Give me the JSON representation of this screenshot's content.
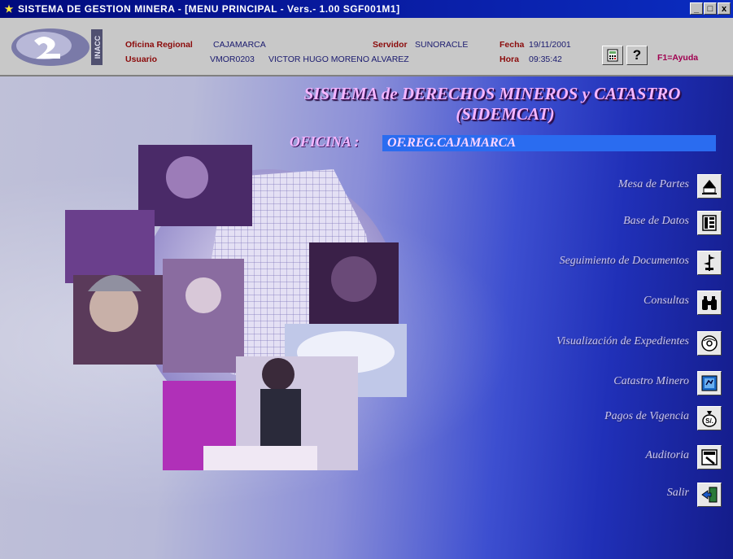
{
  "window": {
    "title": "SISTEMA DE GESTION MINERA - [MENU PRINCIPAL - Vers.- 1.00 SGF001M1]",
    "controls": [
      "_",
      "□",
      "x"
    ]
  },
  "infobar": {
    "oficina_label": "Oficina Regional",
    "oficina_value": "CAJAMARCA",
    "usuario_label": "Usuario",
    "usuario_code": "VMOR0203",
    "usuario_name": "VICTOR HUGO MORENO ALVAREZ",
    "servidor_label": "Servidor",
    "servidor_value": "SUNORACLE",
    "fecha_label": "Fecha",
    "fecha_value": "19/11/2001",
    "hora_label": "Hora",
    "hora_value": "09:35:42",
    "help_symbol": "?",
    "help_hint": "F1=Ayuda"
  },
  "main": {
    "title_line1": "SISTEMA de DERECHOS MINEROS y CATASTRO",
    "title_line2": "(SIDEMCAT)",
    "oficina_label": "OFICINA :",
    "oficina_value": "OF.REG.CAJAMARCA"
  },
  "menu": [
    {
      "label": "Mesa de Partes",
      "icon": "desk-icon"
    },
    {
      "label": "Base de Datos",
      "icon": "database-icon"
    },
    {
      "label": "Seguimiento de Documentos",
      "icon": "tracking-icon"
    },
    {
      "label": "Consultas",
      "icon": "binoculars-icon"
    },
    {
      "label": "Visualización de Expedientes",
      "icon": "disc-icon"
    },
    {
      "label": "Catastro Minero",
      "icon": "map-icon"
    },
    {
      "label": "Pagos de Vigencia",
      "icon": "money-bag-icon"
    },
    {
      "label": "Auditoria",
      "icon": "audit-icon"
    },
    {
      "label": "Salir",
      "icon": "exit-door-icon"
    }
  ],
  "colors": {
    "titlebar": "#000a7c",
    "label_red": "#8b0a0a",
    "value_blue": "#1a1a6e",
    "title_pink": "#f4b6ff",
    "oficina_bar": "#2a6cf0"
  }
}
